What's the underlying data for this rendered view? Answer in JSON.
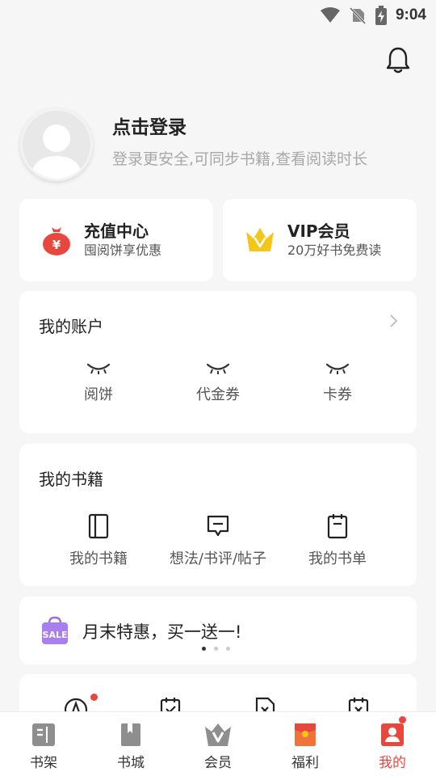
{
  "status_bar": {
    "time": "9:04"
  },
  "profile": {
    "title": "点击登录",
    "subtitle": "登录更安全,可同步书籍,查看阅读时长"
  },
  "promos": [
    {
      "title": "充值中心",
      "subtitle": "囤阅饼享优惠",
      "icon": "money-bag-icon"
    },
    {
      "title": "VIP会员",
      "subtitle": "20万好书免费读",
      "icon": "crown-icon"
    }
  ],
  "account": {
    "title": "我的账户",
    "items": [
      {
        "label": "阅饼",
        "icon": "eye-closed-icon"
      },
      {
        "label": "代金券",
        "icon": "eye-closed-icon"
      },
      {
        "label": "卡券",
        "icon": "eye-closed-icon"
      }
    ]
  },
  "books": {
    "title": "我的书籍",
    "items": [
      {
        "label": "我的书籍",
        "icon": "book-icon"
      },
      {
        "label": "想法/书评/帖子",
        "icon": "comment-icon"
      },
      {
        "label": "我的书单",
        "icon": "booklist-icon"
      }
    ]
  },
  "banner": {
    "text": "月末特惠，买一送一!",
    "icon": "sale-bag-icon",
    "badge": "SALE",
    "page": 1,
    "pages": 3
  },
  "tabs": [
    {
      "label": "书架",
      "icon": "bookshelf-icon",
      "active": false
    },
    {
      "label": "书城",
      "icon": "bookstore-icon",
      "active": false
    },
    {
      "label": "会员",
      "icon": "vip-icon",
      "active": false
    },
    {
      "label": "福利",
      "icon": "gift-icon",
      "active": false
    },
    {
      "label": "我的",
      "icon": "profile-icon",
      "active": true
    }
  ],
  "colors": {
    "accent": "#e8473e",
    "background": "#f6f6f6",
    "gold": "#f5c518"
  }
}
